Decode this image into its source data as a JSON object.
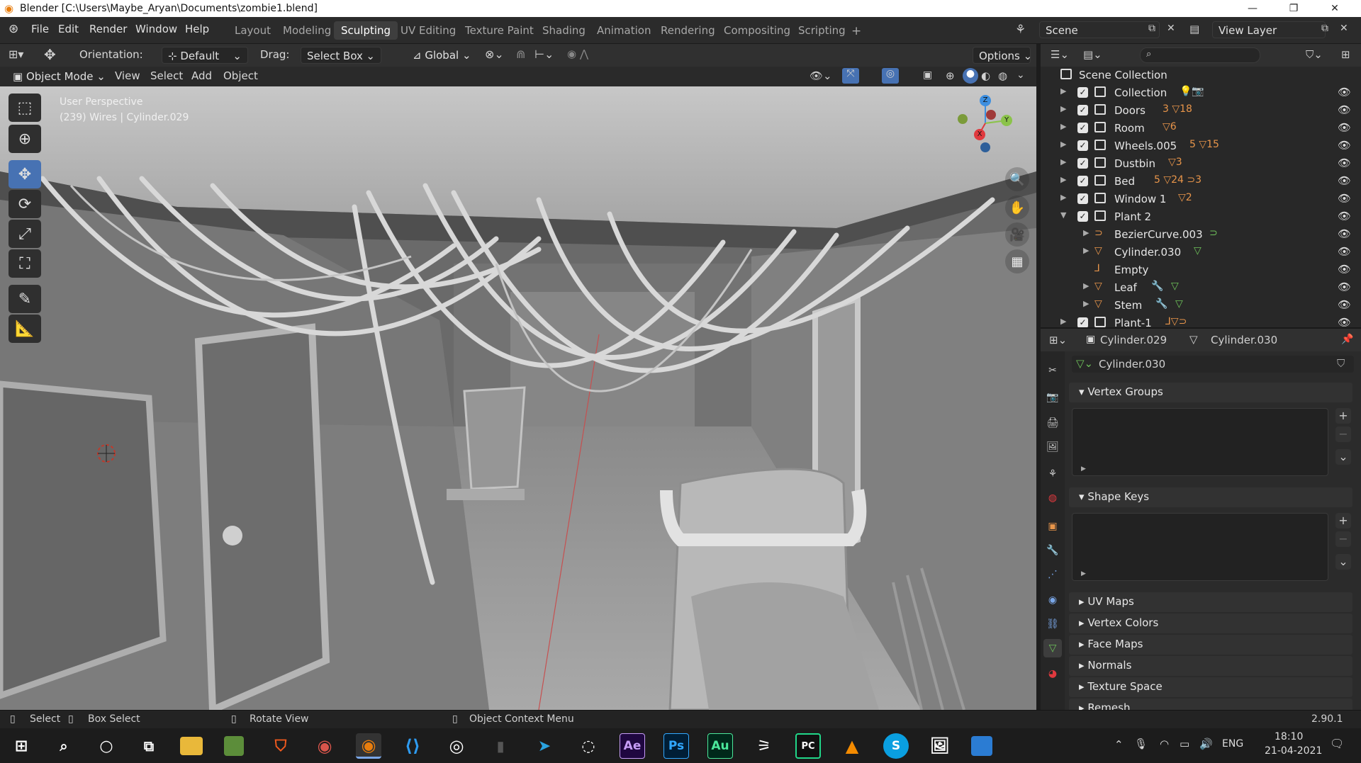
{
  "window": {
    "title": "Blender [C:\\Users\\Maybe_Aryan\\Documents\\zombie1.blend]",
    "minimize": "—",
    "restore": "❐",
    "close": "✕"
  },
  "menu": {
    "items": [
      "File",
      "Edit",
      "Render",
      "Window",
      "Help"
    ]
  },
  "workspaces": [
    "Layout",
    "Modeling",
    "Sculpting",
    "UV Editing",
    "Texture Paint",
    "Shading",
    "Animation",
    "Rendering",
    "Compositing",
    "Scripting"
  ],
  "active_workspace": "Sculpting",
  "add_tab": "+",
  "scene": {
    "name": "Scene",
    "view_layer": "View Layer"
  },
  "tool_header": {
    "orientation_label": "Orientation:",
    "orientation_value": "Default",
    "drag_label": "Drag:",
    "drag_value": "Select Box",
    "transform_space": "Global",
    "options": "Options"
  },
  "viewport_header": {
    "mode": "Object Mode",
    "menus": [
      "View",
      "Select",
      "Add",
      "Object"
    ]
  },
  "viewport": {
    "perspective": "User Perspective",
    "info": "(239) Wires | Cylinder.029",
    "gizmo": {
      "x": "X",
      "y": "Y",
      "z": "Z"
    }
  },
  "outliner": {
    "root": "Scene Collection",
    "rows": [
      {
        "name": "Collection",
        "extra": ""
      },
      {
        "name": "Doors",
        "extra": "3 ▽18"
      },
      {
        "name": "Room",
        "extra": "▽6"
      },
      {
        "name": "Wheels.005",
        "extra": "5 ▽15"
      },
      {
        "name": "Dustbin",
        "extra": "▽3"
      },
      {
        "name": "Bed",
        "extra": "5 ▽24 ⊃3"
      },
      {
        "name": "Window 1",
        "extra": "▽2"
      },
      {
        "name": "Plant 2",
        "extra": ""
      },
      {
        "name": "BezierCurve.003",
        "extra": ""
      },
      {
        "name": "Cylinder.030",
        "extra": ""
      },
      {
        "name": "Empty",
        "extra": ""
      },
      {
        "name": "Leaf",
        "extra": ""
      },
      {
        "name": "Stem",
        "extra": ""
      },
      {
        "name": "Plant-1",
        "extra": ""
      }
    ]
  },
  "properties": {
    "object": "Cylinder.029",
    "mesh": "Cylinder.030",
    "data_name": "Cylinder.030",
    "panels": {
      "vertex_groups": "Vertex Groups",
      "shape_keys": "Shape Keys"
    },
    "collapsed": [
      "UV Maps",
      "Vertex Colors",
      "Face Maps",
      "Normals",
      "Texture Space",
      "Remesh"
    ]
  },
  "status": {
    "select": "Select",
    "box_select": "Box Select",
    "rotate": "Rotate View",
    "context": "Object Context Menu",
    "version": "2.90.1"
  },
  "taskbar": {
    "lang": "ENG",
    "time": "18:10",
    "date": "21-04-2021",
    "apps": [
      "Ae",
      "Ps",
      "Au",
      "PC",
      "S"
    ]
  },
  "colors": {
    "accent": "#4772b3",
    "object_orange": "#e8954a",
    "mesh_green": "#6ec25a",
    "x_axis": "#e0393e",
    "y_axis": "#8bc34a",
    "z_axis": "#3d8fe0"
  }
}
